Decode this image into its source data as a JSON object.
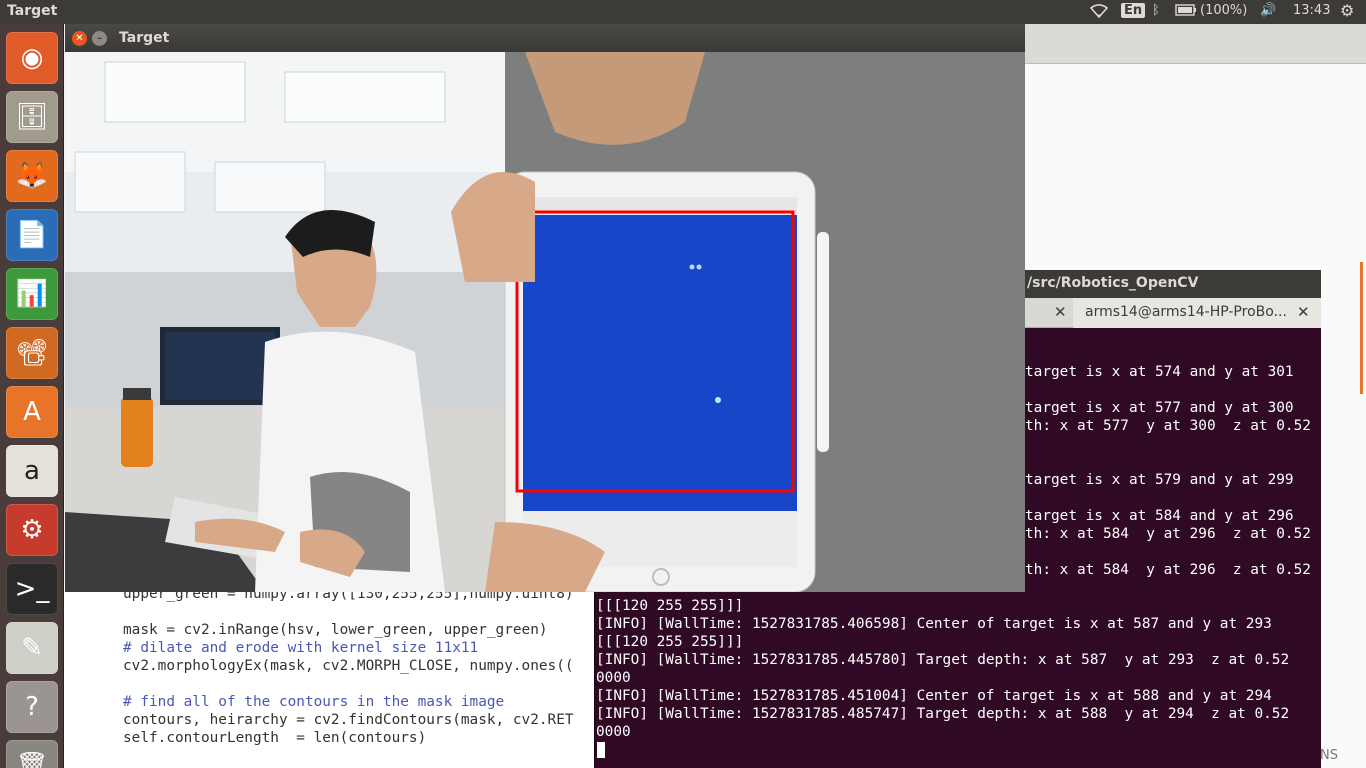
{
  "top_panel": {
    "app_title": "Target",
    "keyboard": "En",
    "battery": "(100%)",
    "clock": "13:43",
    "icons": [
      "wifi-icon",
      "bluetooth-icon",
      "battery-icon",
      "volume-icon",
      "gear-icon"
    ]
  },
  "launcher": {
    "items": [
      {
        "name": "ubuntu-dash-icon",
        "glyph": "◉",
        "color": "#e05a2a"
      },
      {
        "name": "files-icon",
        "glyph": "🗄",
        "color": "#a19b8e"
      },
      {
        "name": "firefox-icon",
        "glyph": "🦊",
        "color": "#e26a1e"
      },
      {
        "name": "writer-icon",
        "glyph": "📄",
        "color": "#2a6cb5"
      },
      {
        "name": "calc-icon",
        "glyph": "📊",
        "color": "#3d9a3a"
      },
      {
        "name": "impress-icon",
        "glyph": "📽",
        "color": "#d06a22"
      },
      {
        "name": "software-center-icon",
        "glyph": "A",
        "color": "#e8742a"
      },
      {
        "name": "amazon-icon",
        "glyph": "a",
        "color": "#e5e0d8"
      },
      {
        "name": "system-settings-icon",
        "glyph": "⚙",
        "color": "#c63b2c"
      },
      {
        "name": "terminal-icon",
        "glyph": ">_",
        "color": "#2a2a2a"
      },
      {
        "name": "text-editor-icon",
        "glyph": "✎",
        "color": "#cfcfc8"
      },
      {
        "name": "help-icon",
        "glyph": "?",
        "color": "#9a9590"
      },
      {
        "name": "trash-icon",
        "glyph": "🗑",
        "color": "#8a8680"
      }
    ]
  },
  "target_window": {
    "title": "Target"
  },
  "terminal": {
    "title": "/src/Robotics_OpenCV",
    "tab2_label": "arms14@arms14-HP-ProBo...",
    "lines": [
      "target is x at 574 and y at 301",
      "target is x at 577 and y at 300",
      "th: x at 577  y at 300  z at 0.52",
      "target is x at 579 and y at 299",
      "target is x at 584 and y at 296",
      "th: x at 584  y at 296  z at 0.52",
      "th: x at 584  y at 296  z at 0.52",
      "0000",
      "[[[120 255 255]]]",
      "[INFO] [WallTime: 1527831785.406598] Center of target is x at 587 and y at 293",
      "[[[120 255 255]]]",
      "[INFO] [WallTime: 1527831785.445780] Target depth: x at 587  y at 293  z at 0.52",
      "0000",
      "[INFO] [WallTime: 1527831785.451004] Center of target is x at 588 and y at 294",
      "[INFO] [WallTime: 1527831785.485747] Target depth: x at 588  y at 294  z at 0.52",
      "0000"
    ]
  },
  "code": {
    "lines": [
      "upper_green = numpy.array([130,255,255],numpy.uint8)",
      "",
      "mask = cv2.inRange(hsv, lower_green, upper_green)",
      "# dilate and erode with kernel size 11x11",
      "cv2.morphologyEx(mask, cv2.MORPH_CLOSE, numpy.ones((",
      "",
      "# find all of the contours in the mask image",
      "contours, heirarchy = cv2.findContours(mask, cv2.RET",
      "self.contourLength  = len(contours)"
    ]
  },
  "bottom_text": "NS"
}
